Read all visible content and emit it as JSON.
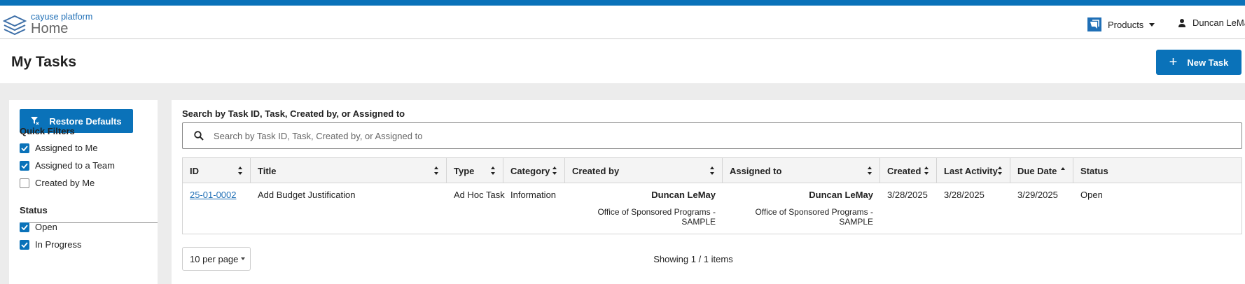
{
  "header": {
    "brand": "cayuse platform",
    "app_name": "Home",
    "products_label": "Products",
    "user_name": "Duncan LeMay",
    "accent_color": "#0a72b9"
  },
  "page": {
    "title": "My Tasks",
    "new_task_label": "New Task"
  },
  "sidebar": {
    "restore_label": "Restore Defaults",
    "quick_filters_title": "Quick Filters",
    "quick_filters": [
      {
        "label": "Assigned to Me",
        "checked": true
      },
      {
        "label": "Assigned to a Team",
        "checked": true
      },
      {
        "label": "Created by Me",
        "checked": false
      }
    ],
    "status_title": "Status",
    "status_filters": [
      {
        "label": "Open",
        "checked": true
      },
      {
        "label": "In Progress",
        "checked": true
      }
    ]
  },
  "search": {
    "label": "Search by Task ID, Task, Created by, or Assigned to",
    "placeholder": "Search by Task ID, Task, Created by, or Assigned to",
    "value": ""
  },
  "table": {
    "columns": [
      "ID",
      "Title",
      "Type",
      "Category",
      "Created by",
      "Assigned to",
      "Created",
      "Last Activity",
      "Due Date",
      "Status"
    ],
    "rows": [
      {
        "id": "25-01-0002",
        "title": "Add Budget Justification",
        "type": "Ad Hoc Task",
        "category": "Information",
        "created_by": "Duncan LeMay",
        "created_by_org": "Office of Sponsored Programs - SAMPLE",
        "assigned_to": "Duncan LeMay",
        "assigned_to_org": "Office of Sponsored Programs - SAMPLE",
        "created": "3/28/2025",
        "last_activity": "3/28/2025",
        "due_date": "3/29/2025",
        "status": "Open"
      }
    ]
  },
  "pagination": {
    "per_page_label": "10 per page",
    "showing_text": "Showing 1 / 1 items"
  }
}
